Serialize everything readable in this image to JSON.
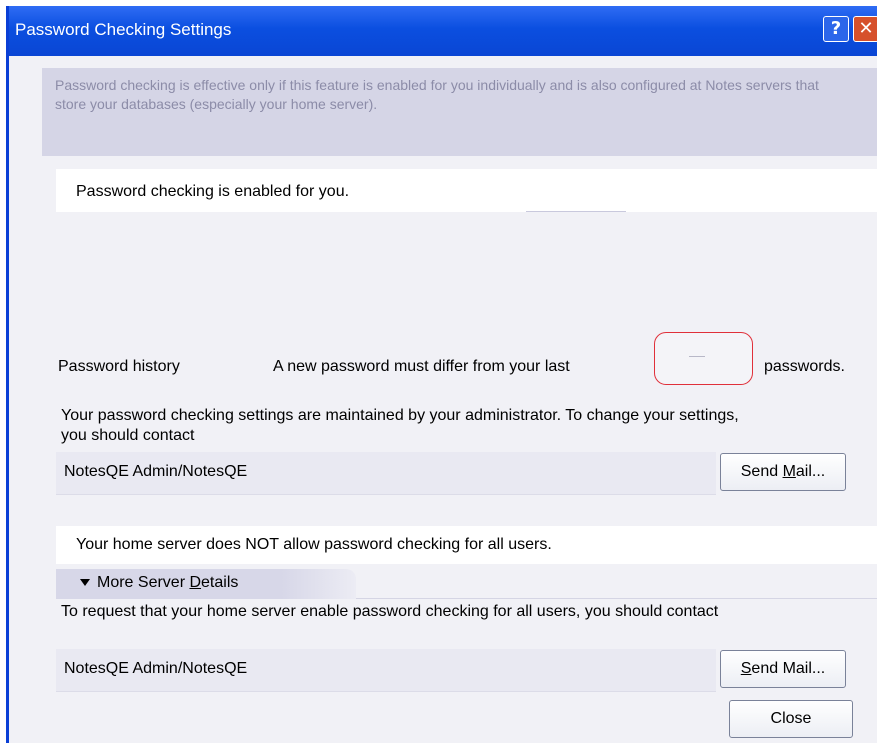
{
  "window": {
    "title": "Password Checking Settings",
    "help_glyph": "?",
    "close_glyph": "✕"
  },
  "info": {
    "text": "Password checking is effective only if this feature is enabled for you individually and is also configured at Notes servers that store your databases (especially your home server)."
  },
  "status": {
    "text": "Password checking is enabled for you."
  },
  "history": {
    "label": "Password history",
    "prefix": "A new password must differ from your last",
    "suffix": "passwords.",
    "value": ""
  },
  "admin": {
    "text": "Your password checking settings are maintained by your administrator.  To change your settings, you should contact",
    "contact": "NotesQE Admin/NotesQE",
    "send_mail_pre": "Send ",
    "send_mail_key": "M",
    "send_mail_post": "ail..."
  },
  "server": {
    "status": "Your home server does NOT allow password checking for all users.",
    "details_pre": "More Server ",
    "details_key": "D",
    "details_post": "etails",
    "request_text": "To request that your home server enable password checking for all users, you should contact",
    "contact": "NotesQE Admin/NotesQE",
    "send_mail_key": "S",
    "send_mail_post": "end Mail..."
  },
  "footer": {
    "close_label": "Close"
  },
  "colors": {
    "titlebar": "#0b4fe0",
    "dialog_bg": "#f1f1f6",
    "info_band": "#d5d5e6",
    "focus_ring": "#e0303a"
  },
  "icons": [
    "help-icon",
    "close-icon",
    "triangle-down-icon"
  ]
}
